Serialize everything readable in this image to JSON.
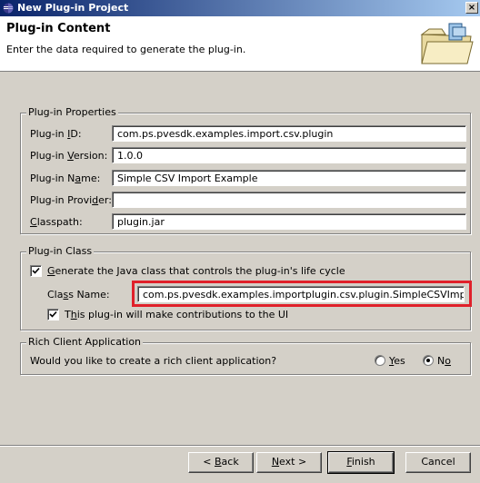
{
  "window": {
    "title": "New Plug-in Project",
    "close_label": "×"
  },
  "banner": {
    "title": "Plug-in Content",
    "description": "Enter the data required to generate the plug-in."
  },
  "properties": {
    "legend": "Plug-in Properties",
    "id_label": [
      "Plug-in ",
      "I",
      "D:"
    ],
    "id_value": "com.ps.pvesdk.examples.import.csv.plugin",
    "version_label": [
      "Plug-in ",
      "V",
      "ersion:"
    ],
    "version_value": "1.0.0",
    "name_label": [
      "Plug-in N",
      "a",
      "me:"
    ],
    "name_value": "Simple CSV Import Example",
    "provider_label": [
      "Plug-in Provi",
      "d",
      "er:"
    ],
    "provider_value": "",
    "classpath_label": [
      "",
      "C",
      "lasspath:"
    ],
    "classpath_value": "plugin.jar"
  },
  "plugin_class": {
    "legend": "Plug-in Class",
    "generate_label": [
      "",
      "G",
      "enerate the Java class that controls the plug-in's life cycle"
    ],
    "generate_checked": true,
    "class_name_label": [
      "Cla",
      "s",
      "s Name:"
    ],
    "class_name_value": "com.ps.pvesdk.examples.importplugin.csv.plugin.SimpleCSVImportPlugin",
    "ui_label": [
      "T",
      "h",
      "is plug-in will make contributions to the UI"
    ],
    "ui_checked": true
  },
  "rcp": {
    "legend": "Rich Client Application",
    "question": "Would you like to create a rich client application?",
    "yes_label": [
      "",
      "Y",
      "es"
    ],
    "no_label": [
      "N",
      "o",
      ""
    ],
    "selected": "No"
  },
  "buttons": {
    "back": [
      "< ",
      "B",
      "ack"
    ],
    "next": [
      "",
      "N",
      "ext >"
    ],
    "finish": [
      "",
      "F",
      "inish"
    ],
    "cancel": "Cancel"
  },
  "colors": {
    "highlight": "#e0202a",
    "title_bar": "#0a246a"
  }
}
